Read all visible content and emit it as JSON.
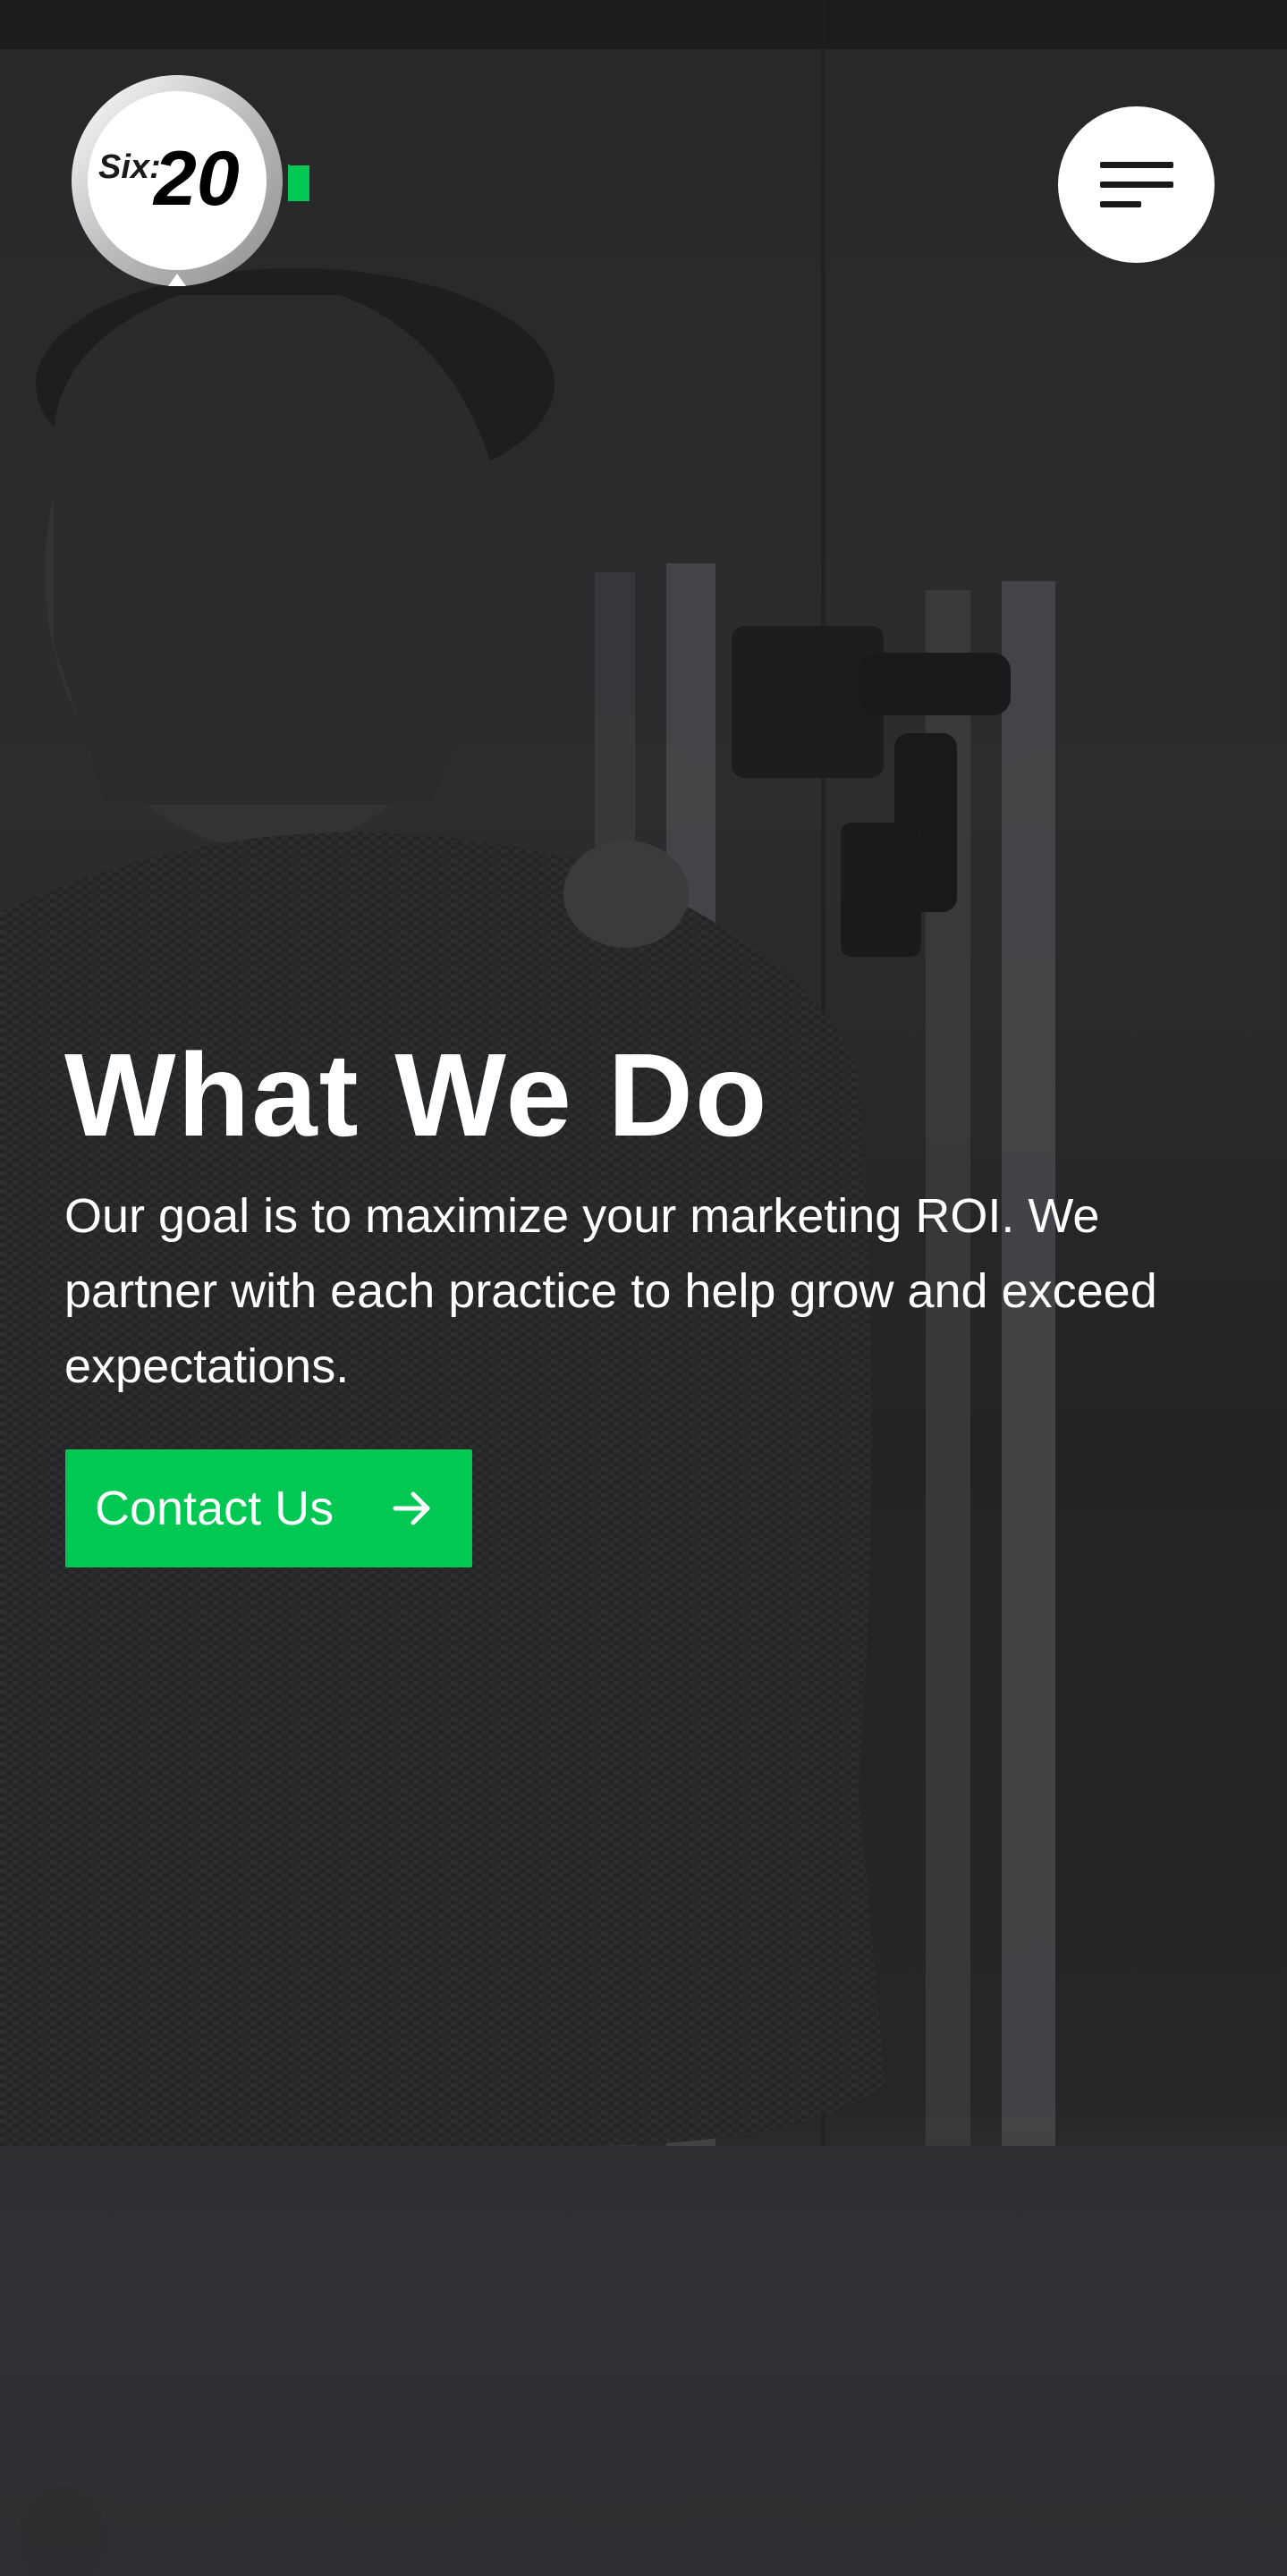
{
  "header": {
    "logo": {
      "prefix": "Six:",
      "number": "20",
      "accent_color": "#00c853"
    },
    "menu_icon": "hamburger-menu-icon"
  },
  "hero": {
    "title": "What We Do",
    "description": "Our goal is to maximize your marketing ROI. We partner with each practice to help grow and exceed expectations.",
    "cta": {
      "label": "Contact Us",
      "icon": "arrow-right-icon",
      "color": "#00c853"
    }
  }
}
